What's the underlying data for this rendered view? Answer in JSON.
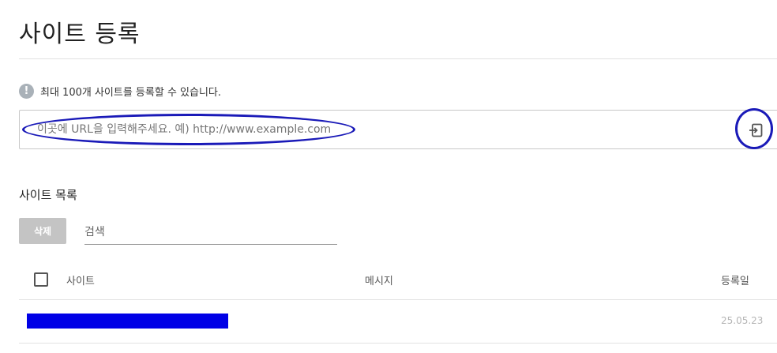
{
  "page": {
    "title": "사이트 등록"
  },
  "notice": {
    "icon": "info-icon",
    "icon_glyph": "!",
    "text": "최대 100개 사이트를 등록할 수 있습니다."
  },
  "url_input": {
    "placeholder": "이곳에 URL을 입력해주세요. 예) http://www.example.com",
    "value": "",
    "submit_icon": "enter-icon"
  },
  "site_list": {
    "title": "사이트 목록",
    "delete_label": "삭제",
    "search_placeholder": "검색",
    "columns": {
      "site": "사이트",
      "message": "메시지",
      "date": "등록일"
    },
    "rows": [
      {
        "site": "",
        "message": "",
        "date": "25.05.23"
      }
    ]
  },
  "colors": {
    "annotation": "#1a1ab8",
    "redaction": "#0000e6",
    "delete_button_bg": "#c4c4c4"
  }
}
